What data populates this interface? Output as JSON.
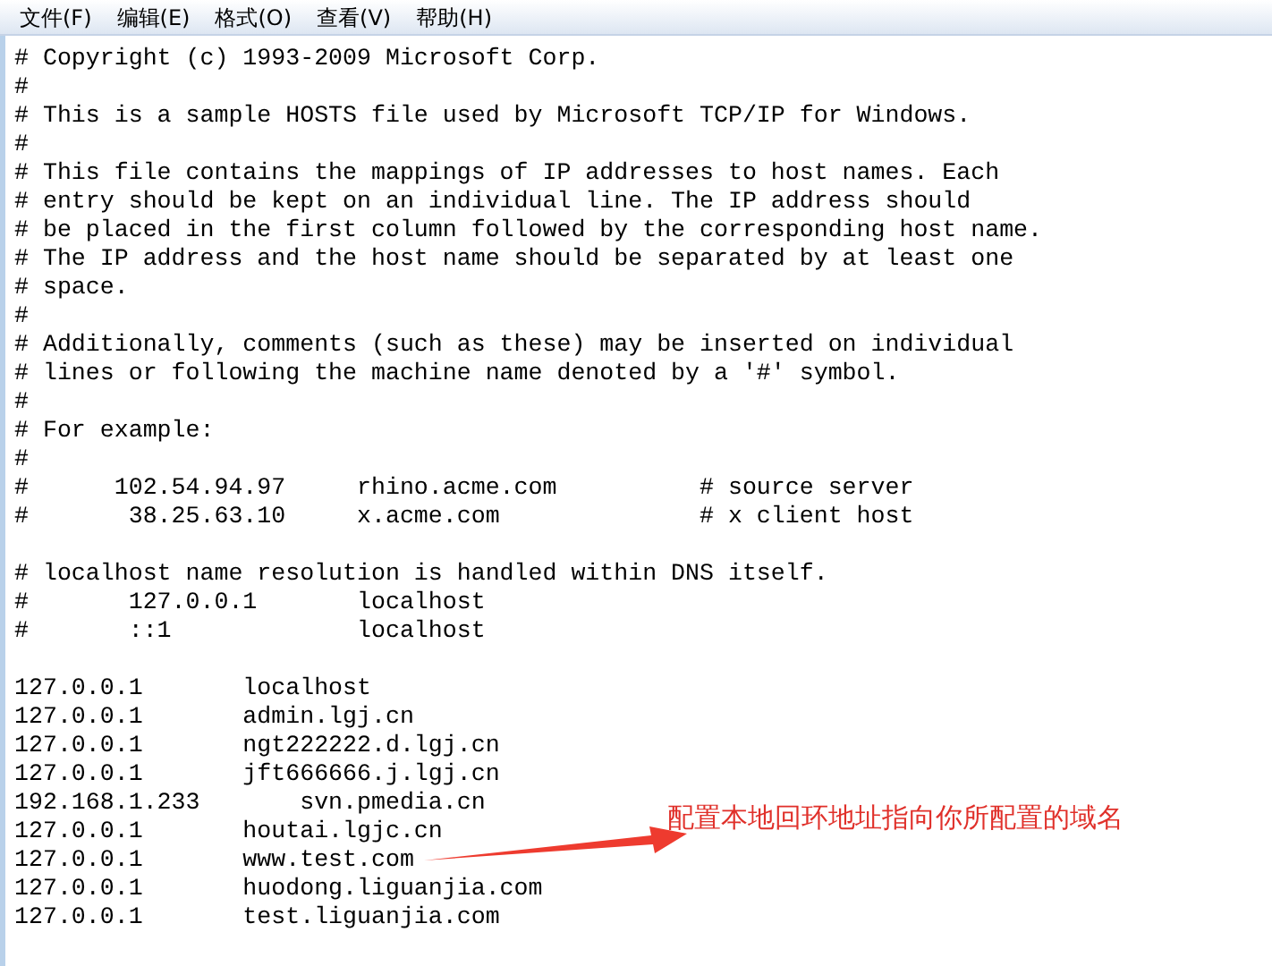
{
  "menu": [
    "文件(F)",
    "编辑(E)",
    "格式(O)",
    "查看(V)",
    "帮助(H)"
  ],
  "blocks": [
    [
      "# Copyright (c) 1993-2009 Microsoft Corp.",
      "#",
      "# This is a sample HOSTS file used by Microsoft TCP/IP for Windows.",
      "#",
      "# This file contains the mappings of IP addresses to host names. Each",
      "# entry should be kept on an individual line. The IP address should",
      "# be placed in the first column followed by the corresponding host name.",
      "# The IP address and the host name should be separated by at least one",
      "# space.",
      "#",
      "# Additionally, comments (such as these) may be inserted on individual",
      "# lines or following the machine name denoted by a '#' symbol.",
      "#",
      "# For example:",
      "#",
      "#      102.54.94.97     rhino.acme.com          # source server",
      "#       38.25.63.10     x.acme.com              # x client host"
    ],
    [
      "# localhost name resolution is handled within DNS itself.",
      "#       127.0.0.1       localhost",
      "#       ::1             localhost"
    ],
    [
      "127.0.0.1       localhost",
      "127.0.0.1       admin.lgj.cn",
      "127.0.0.1       ngt222222.d.lgj.cn",
      "127.0.0.1       jft666666.j.lgj.cn",
      "192.168.1.233       svn.pmedia.cn",
      "127.0.0.1       houtai.lgjc.cn",
      "127.0.0.1       www.test.com",
      "127.0.0.1       huodong.liguanjia.com",
      "127.0.0.1       test.liguanjia.com"
    ]
  ],
  "annotation": {
    "text": "配置本地回环地址指向你所配置的域名"
  }
}
